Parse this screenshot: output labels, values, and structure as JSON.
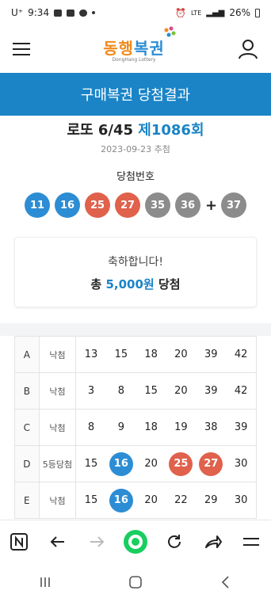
{
  "status": {
    "carrier": "U⁺",
    "time": "9:34",
    "network": "LTE",
    "battery": "26%"
  },
  "header": {
    "logo_text_a": "동행",
    "logo_text_b": "복권",
    "logo_sub": "DongHang Lottery"
  },
  "banner": {
    "title": "구매복권 당첨결과"
  },
  "summary": {
    "game": "로또 6/45",
    "round": "제1086회",
    "draw_date": "2023-09-23 추첨",
    "win_label": "당첨번호",
    "numbers": [
      {
        "value": "11",
        "color": "#2c8dd4"
      },
      {
        "value": "16",
        "color": "#2c8dd4"
      },
      {
        "value": "25",
        "color": "#e0614c"
      },
      {
        "value": "27",
        "color": "#e0614c"
      },
      {
        "value": "35",
        "color": "#8c8c8c"
      },
      {
        "value": "36",
        "color": "#8c8c8c"
      }
    ],
    "plus": "+",
    "bonus": {
      "value": "37",
      "color": "#8c8c8c"
    }
  },
  "congrats": {
    "line1": "축하합니다!",
    "prefix": "총",
    "amount": "5,000원",
    "suffix": "당첨"
  },
  "games": [
    {
      "id": "A",
      "result": "낙첨",
      "numbers": [
        "13",
        "15",
        "18",
        "20",
        "39",
        "42"
      ],
      "hits": []
    },
    {
      "id": "B",
      "result": "낙첨",
      "numbers": [
        "3",
        "8",
        "15",
        "20",
        "39",
        "42"
      ],
      "hits": []
    },
    {
      "id": "C",
      "result": "낙첨",
      "numbers": [
        "8",
        "9",
        "18",
        "19",
        "38",
        "39"
      ],
      "hits": []
    },
    {
      "id": "D",
      "result": "5등당첨",
      "numbers": [
        "15",
        "16",
        "20",
        "25",
        "27",
        "30"
      ],
      "hits": [
        1,
        3,
        4
      ]
    },
    {
      "id": "E",
      "result": "낙첨",
      "numbers": [
        "15",
        "16",
        "20",
        "22",
        "29",
        "30"
      ],
      "hits": [
        1
      ]
    }
  ],
  "colors": {
    "blue": "#2c8dd4",
    "red": "#e0614c",
    "accent": "#1a84c7"
  }
}
